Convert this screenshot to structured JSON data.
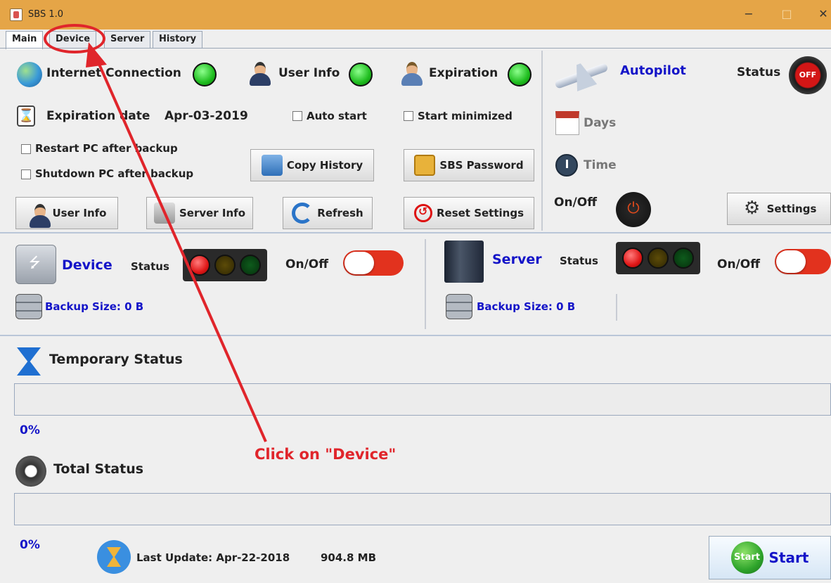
{
  "window": {
    "title": "SBS 1.0",
    "min": "−",
    "max": "□",
    "close": "✕"
  },
  "tabs": [
    {
      "label": "Main"
    },
    {
      "label": "Device"
    },
    {
      "label": "Server"
    },
    {
      "label": "History"
    }
  ],
  "main": {
    "internet_connection": "Internet Connection",
    "user_info": "User Info",
    "expiration": "Expiration",
    "expiration_date_label": "Expiration date",
    "expiration_date_value": "Apr-03-2019",
    "auto_start": "Auto start",
    "start_minimized": "Start minimized",
    "restart_pc": "Restart PC after backup",
    "shutdown_pc": "Shutdown PC after backup",
    "copy_history": "Copy History",
    "sbs_password": "SBS Password",
    "user_info_btn": "User Info",
    "server_info_btn": "Server Info",
    "refresh_btn": "Refresh",
    "reset_settings_btn": "Reset Settings"
  },
  "autopilot": {
    "title": "Autopilot",
    "status_label": "Status",
    "status_badge": "OFF",
    "days": "Days",
    "time": "Time",
    "onoff": "On/Off",
    "settings": "Settings"
  },
  "device": {
    "title": "Device",
    "status_label": "Status",
    "onoff": "On/Off",
    "backup_size": "Backup Size:  0 B"
  },
  "server": {
    "title": "Server",
    "status_label": "Status",
    "onoff": "On/Off",
    "backup_size": "Backup Size:  0 B"
  },
  "temporary": {
    "title": "Temporary Status",
    "percent": "0%"
  },
  "total": {
    "title": "Total Status",
    "percent": "0%"
  },
  "footer": {
    "last_update": "Last Update: Apr-22-2018",
    "size": "904.8 MB",
    "start_icon": "Start",
    "start_label": "Start"
  },
  "annotation": {
    "text": "Click on \"Device\"",
    "color": "#e0252b"
  }
}
